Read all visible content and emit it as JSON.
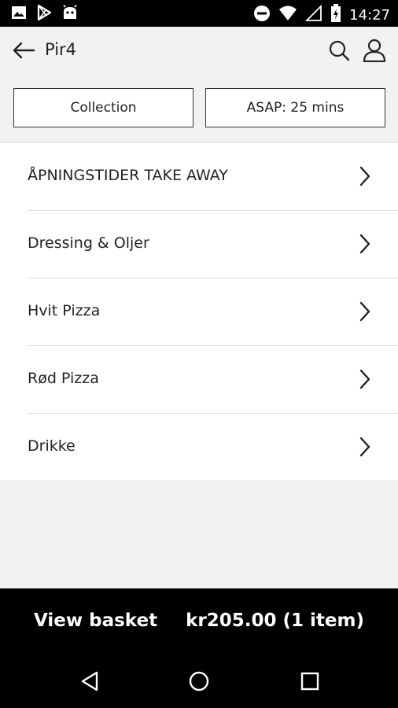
{
  "status_bar": {
    "time": "14:27",
    "left_icons": [
      "image-icon",
      "play-store-icon",
      "android-icon"
    ],
    "right_icons": [
      "do-not-disturb-icon",
      "wifi-icon",
      "signal-icon",
      "battery-charging-icon"
    ]
  },
  "header": {
    "title": "Pir4",
    "back_icon": "arrow-left-icon",
    "search_icon": "search-icon",
    "account_icon": "person-icon"
  },
  "order_options": {
    "collection_label": "Collection",
    "time_label": "ASAP: 25 mins"
  },
  "menu": {
    "items": [
      {
        "label": "ÅPNINGSTIDER TAKE AWAY"
      },
      {
        "label": "Dressing & Oljer"
      },
      {
        "label": "Hvit Pizza"
      },
      {
        "label": "Rød Pizza"
      },
      {
        "label": "Drikke"
      }
    ]
  },
  "basket": {
    "view_label": "View basket",
    "total_label": "kr205.00 (1 item)"
  },
  "colors": {
    "background": "#f2f2f2",
    "bar": "#000000",
    "text": "#222222",
    "divider": "#dcdcdc"
  }
}
